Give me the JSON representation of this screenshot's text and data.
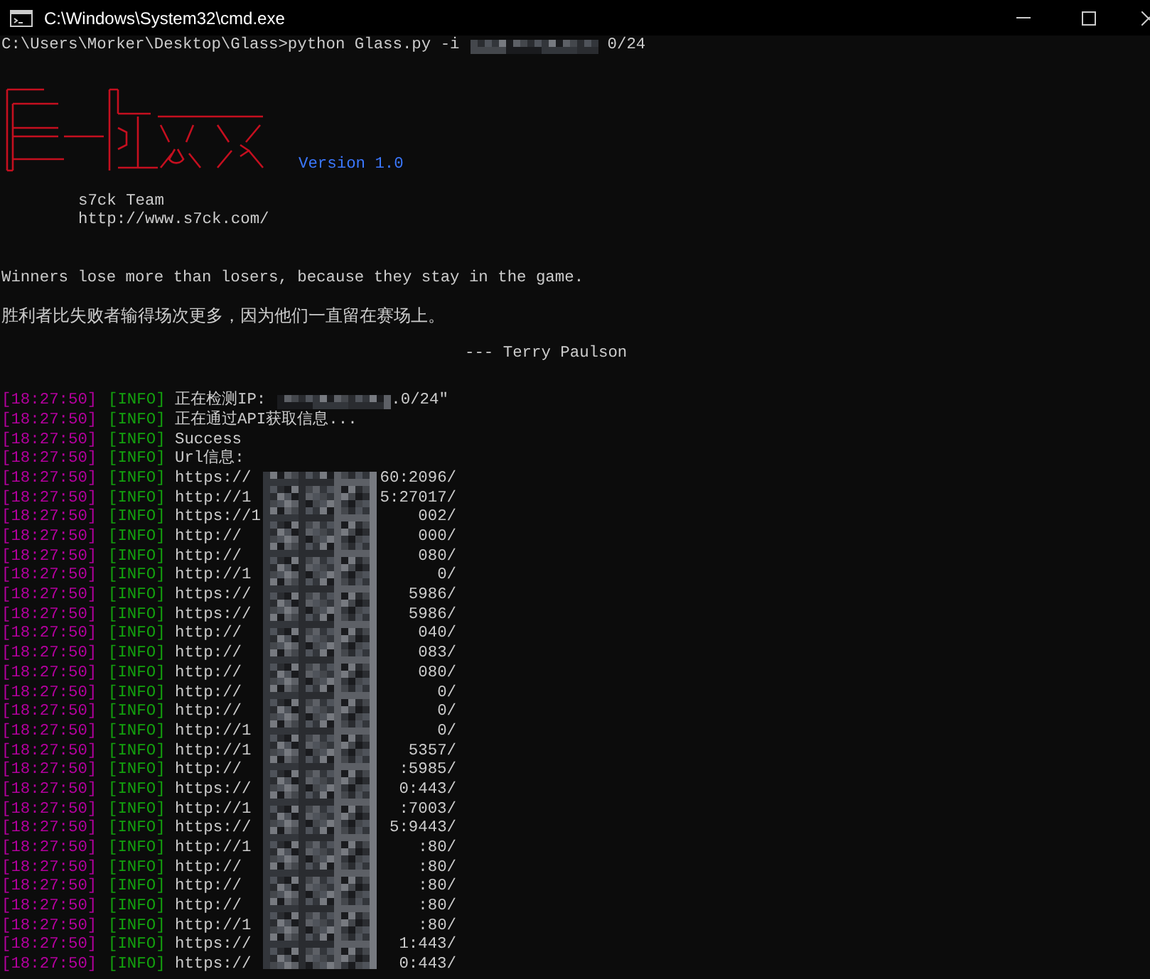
{
  "window": {
    "title": "C:\\Windows\\System32\\cmd.exe"
  },
  "command": {
    "prompt": "C:\\Users\\Morker\\Desktop\\Glass>python Glass.py -i",
    "suffix": "0/24"
  },
  "banner": {
    "version": "Version 1.0",
    "team": "s7ck Team",
    "url": "http://www.s7ck.com/",
    "quote": "Winners lose more than losers, because they stay in the game.",
    "quote_translation": "胜利者比失败者输得场次更多，因为他们一直留在赛场上。",
    "author": "--- Terry Paulson"
  },
  "log": [
    {
      "time": "[18:27:50]",
      "level": "[INFO]",
      "kind": "ip",
      "prefix": "正在检测IP:",
      "suffix": ".0/24\""
    },
    {
      "time": "[18:27:50]",
      "level": "[INFO]",
      "kind": "text",
      "prefix": "正在通过API获取信息..."
    },
    {
      "time": "[18:27:50]",
      "level": "[INFO]",
      "kind": "text",
      "prefix": "Success"
    },
    {
      "time": "[18:27:50]",
      "level": "[INFO]",
      "kind": "text",
      "prefix": "Url信息:"
    },
    {
      "time": "[18:27:50]",
      "level": "[INFO]",
      "kind": "url",
      "prefix": "https://",
      "suffix": "60:2096/"
    },
    {
      "time": "[18:27:50]",
      "level": "[INFO]",
      "kind": "url",
      "prefix": "http://1",
      "suffix": "5:27017/"
    },
    {
      "time": "[18:27:50]",
      "level": "[INFO]",
      "kind": "url",
      "prefix": "https://1",
      "suffix": "002/"
    },
    {
      "time": "[18:27:50]",
      "level": "[INFO]",
      "kind": "url",
      "prefix": "http://",
      "suffix": "000/"
    },
    {
      "time": "[18:27:50]",
      "level": "[INFO]",
      "kind": "url",
      "prefix": "http://",
      "suffix": "080/"
    },
    {
      "time": "[18:27:50]",
      "level": "[INFO]",
      "kind": "url",
      "prefix": "http://1",
      "suffix": "0/"
    },
    {
      "time": "[18:27:50]",
      "level": "[INFO]",
      "kind": "url",
      "prefix": "https://",
      "suffix": "5986/"
    },
    {
      "time": "[18:27:50]",
      "level": "[INFO]",
      "kind": "url",
      "prefix": "https://",
      "suffix": "5986/"
    },
    {
      "time": "[18:27:50]",
      "level": "[INFO]",
      "kind": "url",
      "prefix": "http://",
      "suffix": "040/"
    },
    {
      "time": "[18:27:50]",
      "level": "[INFO]",
      "kind": "url",
      "prefix": "http://",
      "suffix": "083/"
    },
    {
      "time": "[18:27:50]",
      "level": "[INFO]",
      "kind": "url",
      "prefix": "http://",
      "suffix": "080/"
    },
    {
      "time": "[18:27:50]",
      "level": "[INFO]",
      "kind": "url",
      "prefix": "http://",
      "suffix": "0/"
    },
    {
      "time": "[18:27:50]",
      "level": "[INFO]",
      "kind": "url",
      "prefix": "http://",
      "suffix": "0/"
    },
    {
      "time": "[18:27:50]",
      "level": "[INFO]",
      "kind": "url",
      "prefix": "http://1",
      "suffix": "0/"
    },
    {
      "time": "[18:27:50]",
      "level": "[INFO]",
      "kind": "url",
      "prefix": "http://1",
      "suffix": "5357/"
    },
    {
      "time": "[18:27:50]",
      "level": "[INFO]",
      "kind": "url",
      "prefix": "http://",
      "suffix": ":5985/"
    },
    {
      "time": "[18:27:50]",
      "level": "[INFO]",
      "kind": "url",
      "prefix": "https://",
      "suffix": "0:443/"
    },
    {
      "time": "[18:27:50]",
      "level": "[INFO]",
      "kind": "url",
      "prefix": "http://1",
      "suffix": ":7003/"
    },
    {
      "time": "[18:27:50]",
      "level": "[INFO]",
      "kind": "url",
      "prefix": "https://",
      "suffix": "5:9443/"
    },
    {
      "time": "[18:27:50]",
      "level": "[INFO]",
      "kind": "url",
      "prefix": "http://1",
      "suffix": ":80/"
    },
    {
      "time": "[18:27:50]",
      "level": "[INFO]",
      "kind": "url",
      "prefix": "http://",
      "suffix": ":80/"
    },
    {
      "time": "[18:27:50]",
      "level": "[INFO]",
      "kind": "url",
      "prefix": "http://",
      "suffix": ":80/"
    },
    {
      "time": "[18:27:50]",
      "level": "[INFO]",
      "kind": "url",
      "prefix": "http://",
      "suffix": ":80/"
    },
    {
      "time": "[18:27:50]",
      "level": "[INFO]",
      "kind": "url",
      "prefix": "http://1",
      "suffix": ":80/"
    },
    {
      "time": "[18:27:50]",
      "level": "[INFO]",
      "kind": "url",
      "prefix": "https://",
      "suffix": "1:443/"
    },
    {
      "time": "[18:27:50]",
      "level": "[INFO]",
      "kind": "url",
      "prefix": "https://",
      "suffix": "0:443/"
    }
  ]
}
